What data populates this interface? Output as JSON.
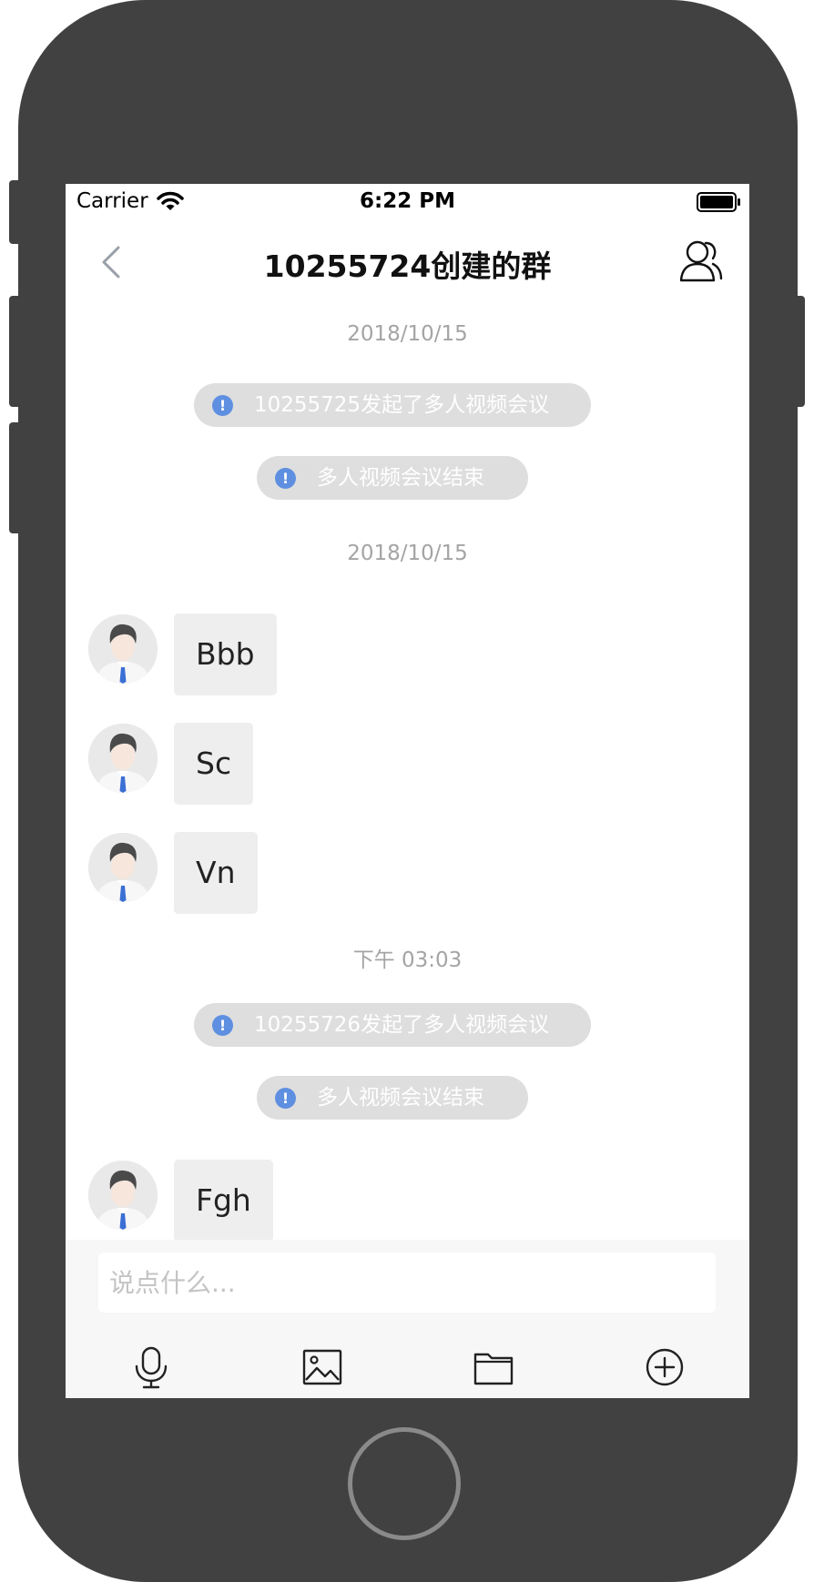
{
  "status_bar": {
    "carrier": "Carrier",
    "time": "6:22 PM"
  },
  "nav": {
    "title": "10255724创建的群"
  },
  "chat": {
    "dates": [
      "2018/10/15",
      "2018/10/15",
      "下午 03:03"
    ],
    "system_messages": [
      "10255725发起了多人视频会议",
      "多人视频会议结束",
      "10255726发起了多人视频会议",
      "多人视频会议结束"
    ],
    "messages": [
      {
        "text": "Bbb"
      },
      {
        "text": "Sc"
      },
      {
        "text": "Vn"
      },
      {
        "text": "Fgh"
      }
    ]
  },
  "input": {
    "placeholder": "说点什么...",
    "value": ""
  },
  "toolbar": {
    "items": [
      {
        "icon": "microphone-icon"
      },
      {
        "icon": "image-icon"
      },
      {
        "icon": "folder-icon"
      },
      {
        "icon": "plus-circle-icon"
      }
    ]
  },
  "colors": {
    "phone_frame": "#414141",
    "info_icon": "#5e8fe0",
    "system_pill": "#dedede",
    "bubble": "#eeeeee",
    "date_text": "#a4a4a4"
  }
}
